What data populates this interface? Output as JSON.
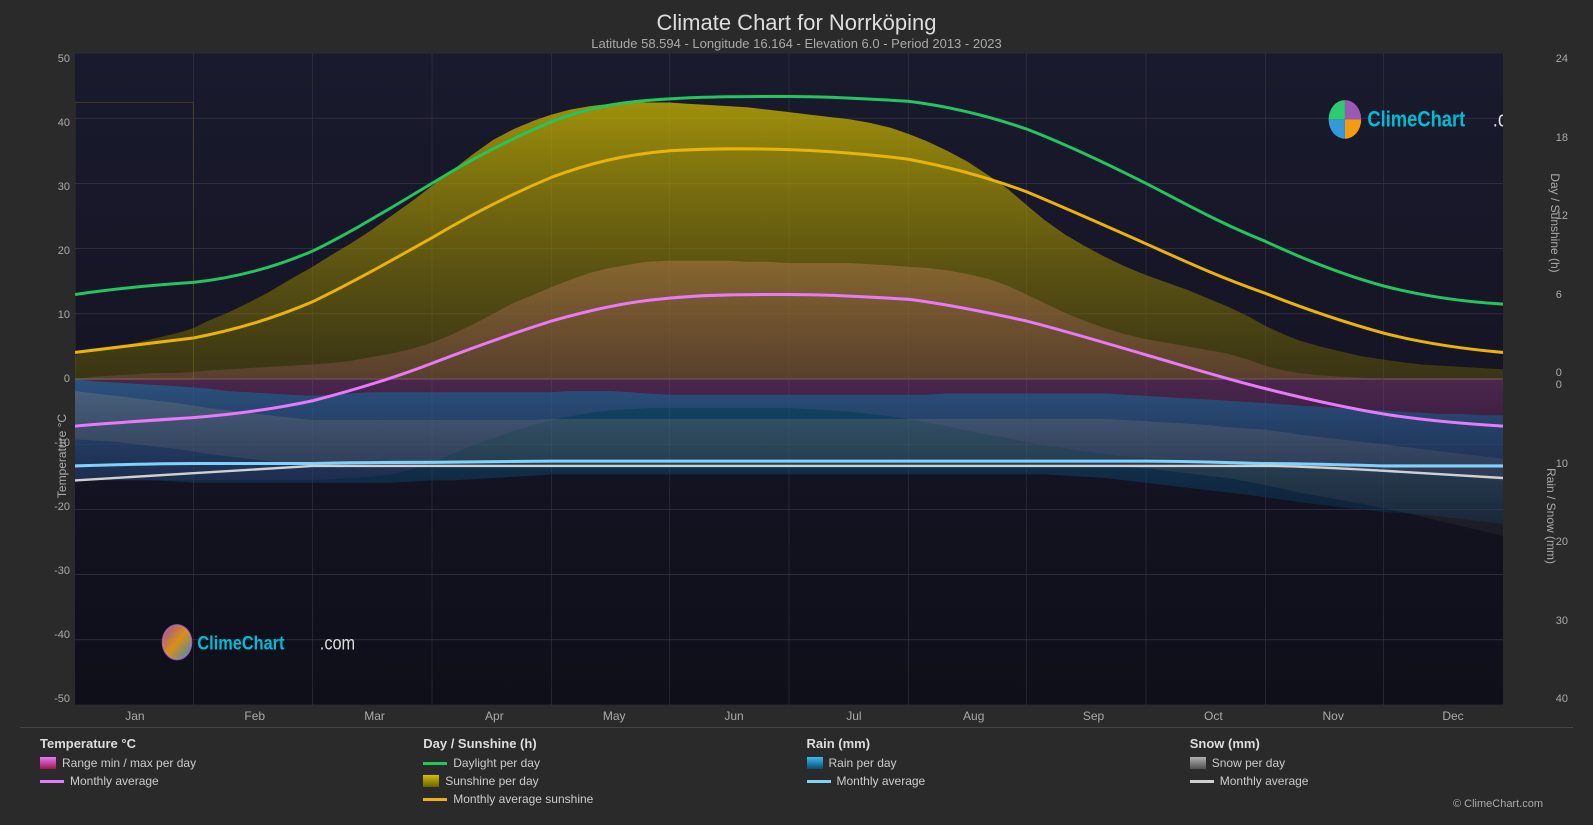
{
  "header": {
    "title": "Climate Chart for Norrköping",
    "subtitle": "Latitude 58.594 - Longitude 16.164 - Elevation 6.0 - Period 2013 - 2023"
  },
  "chart": {
    "y_left_labels": [
      "50",
      "40",
      "30",
      "20",
      "10",
      "0",
      "-10",
      "-20",
      "-30",
      "-40",
      "-50"
    ],
    "y_left_axis_label": "Temperature °C",
    "y_right_sunshine_labels": [
      "24",
      "18",
      "12",
      "6",
      "0"
    ],
    "y_right_sunshine_label": "Day / Sunshine (h)",
    "y_right_rain_labels": [
      "0",
      "10",
      "20",
      "30",
      "40"
    ],
    "y_right_rain_label": "Rain / Snow (mm)",
    "x_labels": [
      "Jan",
      "Feb",
      "Mar",
      "Apr",
      "May",
      "Jun",
      "Jul",
      "Aug",
      "Sep",
      "Oct",
      "Nov",
      "Dec"
    ]
  },
  "legend": {
    "temp_title": "Temperature °C",
    "temp_items": [
      {
        "type": "swatch",
        "color": "#d946a8",
        "label": "Range min / max per day"
      },
      {
        "type": "line",
        "color": "#e879f9",
        "label": "Monthly average"
      }
    ],
    "sunshine_title": "Day / Sunshine (h)",
    "sunshine_items": [
      {
        "type": "line",
        "color": "#22c55e",
        "label": "Daylight per day"
      },
      {
        "type": "swatch",
        "color": "#c8b400",
        "label": "Sunshine per day"
      },
      {
        "type": "line",
        "color": "#eab308",
        "label": "Monthly average sunshine"
      }
    ],
    "rain_title": "Rain (mm)",
    "rain_items": [
      {
        "type": "swatch",
        "color": "#38bdf8",
        "label": "Rain per day"
      },
      {
        "type": "line",
        "color": "#7dd3fc",
        "label": "Monthly average"
      }
    ],
    "snow_title": "Snow (mm)",
    "snow_items": [
      {
        "type": "swatch",
        "color": "#b0b0b0",
        "label": "Snow per day"
      },
      {
        "type": "line",
        "color": "#d0d0d0",
        "label": "Monthly average"
      }
    ]
  },
  "logo": {
    "text": "ClimeChart",
    "domain": ".com"
  },
  "footer": {
    "credit": "© ClimeChart.com"
  }
}
